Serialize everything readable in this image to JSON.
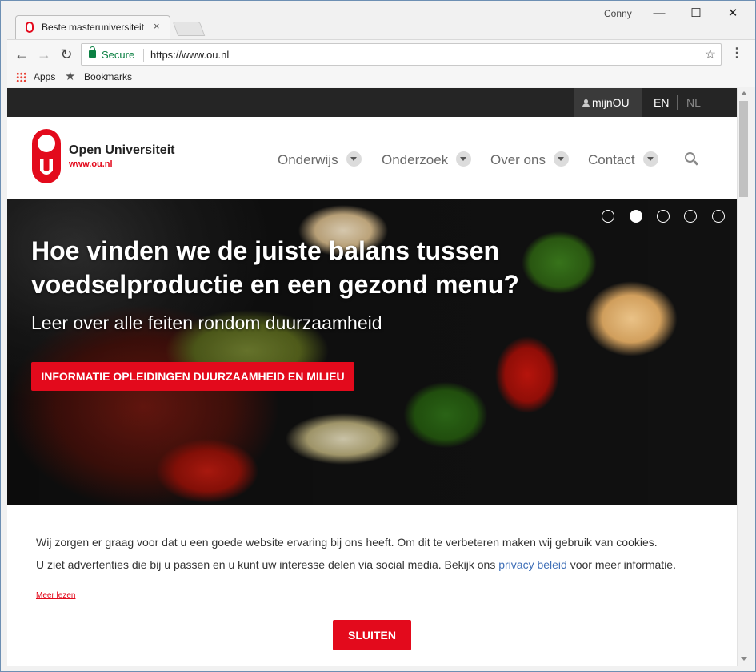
{
  "browser": {
    "tab_title": "Beste masteruniversiteit",
    "tab_close": "×",
    "window_user": "Conny",
    "win_minimize": "—",
    "win_maximize": "☐",
    "win_close": "✕",
    "back": "←",
    "forward": "→",
    "reload": "↻",
    "secure_label": "Secure",
    "url": "https://www.ou.nl",
    "star": "☆",
    "menu": "⋮",
    "bookmarks": {
      "apps_label": "Apps",
      "bookmarks_label": "Bookmarks",
      "star": "★"
    }
  },
  "site": {
    "topbar": {
      "account_label": "mijnOU",
      "lang_en": "EN",
      "lang_nl": "NL"
    },
    "logo": {
      "name": "Open Universiteit",
      "url": "www.ou.nl",
      "color": "#e30a1c"
    },
    "menu": [
      {
        "label": "Onderwijs"
      },
      {
        "label": "Onderzoek"
      },
      {
        "label": "Over ons"
      },
      {
        "label": "Contact"
      }
    ],
    "hero": {
      "title": "Hoe vinden we de juiste balans tussen voedselproductie en een gezond menu?",
      "subtitle": "Leer over alle feiten rondom duurzaamheid",
      "cta": "INFORMATIE OPLEIDINGEN DUURZAAMHEID EN MILIEU",
      "slide_count": 5,
      "active_slide": 2
    },
    "cookie": {
      "line1": "Wij zorgen er graag voor dat u een goede website ervaring bij ons heeft. Om dit te verbeteren maken wij gebruik van cookies.",
      "line2_before": "U ziet advertenties die bij u passen en u kunt uw interesse delen via social media. Bekijk ons ",
      "link": "privacy beleid",
      "line2_after": " voor meer informatie.",
      "more": "Meer lezen",
      "close_button": "SLUITEN"
    },
    "accent_color": "#e30a1c"
  }
}
